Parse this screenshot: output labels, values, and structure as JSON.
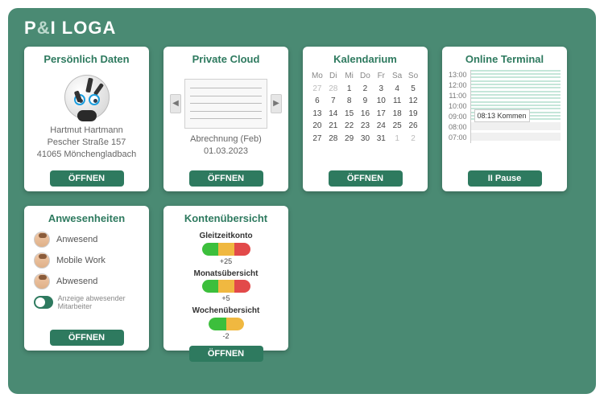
{
  "app_name_parts": {
    "p": "P",
    "amp": "&",
    "rest": "I LOGA"
  },
  "tiles": {
    "personal": {
      "title": "Persönlich Daten",
      "name": "Hartmut Hartmann",
      "street": "Pescher Straße 157",
      "city": "41065 Mönchengladbach",
      "open": "ÖFFNEN"
    },
    "cloud": {
      "title": "Private Cloud",
      "doc_title": "Abrechnung (Feb)",
      "doc_date": "01.03.2023",
      "open": "ÖFFNEN"
    },
    "calendar": {
      "title": "Kalendarium",
      "days": [
        "Mo",
        "Di",
        "Mi",
        "Do",
        "Fr",
        "Sa",
        "So"
      ],
      "rows": [
        [
          {
            "v": "27",
            "d": true
          },
          {
            "v": "28",
            "d": true
          },
          {
            "v": "1"
          },
          {
            "v": "2"
          },
          {
            "v": "3"
          },
          {
            "v": "4"
          },
          {
            "v": "5"
          }
        ],
        [
          {
            "v": "6"
          },
          {
            "v": "7"
          },
          {
            "v": "8"
          },
          {
            "v": "9"
          },
          {
            "v": "10"
          },
          {
            "v": "11"
          },
          {
            "v": "12"
          }
        ],
        [
          {
            "v": "13"
          },
          {
            "v": "14"
          },
          {
            "v": "15"
          },
          {
            "v": "16"
          },
          {
            "v": "17"
          },
          {
            "v": "18"
          },
          {
            "v": "19"
          }
        ],
        [
          {
            "v": "20"
          },
          {
            "v": "21"
          },
          {
            "v": "22"
          },
          {
            "v": "23"
          },
          {
            "v": "24"
          },
          {
            "v": "25"
          },
          {
            "v": "26"
          }
        ],
        [
          {
            "v": "27"
          },
          {
            "v": "28"
          },
          {
            "v": "29"
          },
          {
            "v": "30"
          },
          {
            "v": "31"
          },
          {
            "v": "1",
            "d": true
          },
          {
            "v": "2",
            "d": true
          }
        ]
      ],
      "open": "ÖFFNEN"
    },
    "terminal": {
      "title": "Online Terminal",
      "hours": [
        "13:00",
        "12:00",
        "11:00",
        "10:00",
        "09:00",
        "08:00",
        "07:00"
      ],
      "event": "08:13 Kommen",
      "pause": "II  Pause"
    },
    "attendance": {
      "title": "Anwesenheiten",
      "rows": [
        "Anwesend",
        "Mobile Work",
        "Abwesend"
      ],
      "toggle_note": "Anzeige abwesender Mitarbeiter",
      "open": "ÖFFNEN"
    },
    "konten": {
      "title": "Kontenübersicht",
      "items": [
        {
          "label": "Gleitzeitkonto",
          "val": "+25"
        },
        {
          "label": "Monatsübersicht",
          "val": "+5"
        },
        {
          "label": "Wochenübersicht",
          "val": "-2"
        }
      ],
      "open": "ÖFFNEN"
    }
  }
}
